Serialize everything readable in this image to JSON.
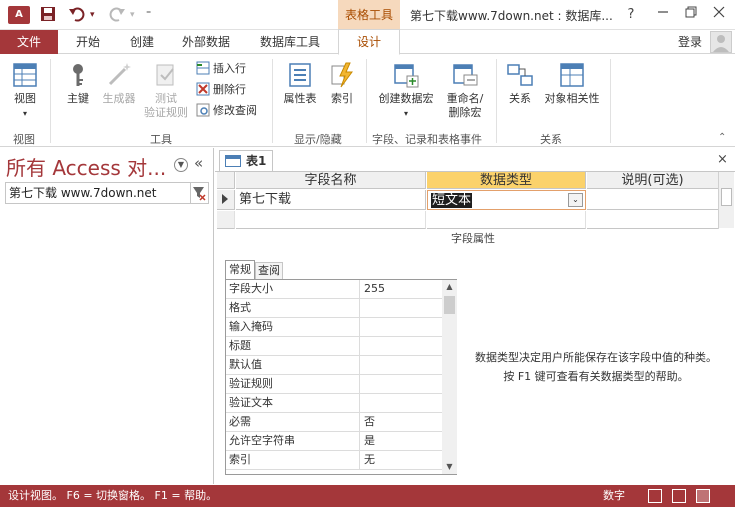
{
  "titlebar": {
    "app_logo": "A",
    "contextual_tab_title": "表格工具",
    "window_title": "第七下载www.7down.net : 数据库...",
    "help_label": "?",
    "qat_icons": [
      "save-icon",
      "undo-icon",
      "redo-icon",
      "customize-qat-icon"
    ],
    "minimize_icon": "minimize-icon",
    "restore_icon": "restore-icon",
    "close_icon": "close-icon"
  },
  "tabs": {
    "file": "文件",
    "items": [
      "开始",
      "创建",
      "外部数据",
      "数据库工具"
    ],
    "design": "设计",
    "login": "登录"
  },
  "ribbon": {
    "view": {
      "label": "视图",
      "group": "视图",
      "icon": "view-icon"
    },
    "tools": {
      "group": "工具",
      "primary_key": "主键",
      "builder": "生成器",
      "test_rules_1": "测试",
      "test_rules_2": "验证规则",
      "insert_row": "插入行",
      "delete_row": "删除行",
      "modify_lookups": "修改查阅"
    },
    "show_hide": {
      "group": "显示/隐藏",
      "property_sheet": "属性表",
      "indexes": "索引"
    },
    "events": {
      "group": "字段、记录和表格事件",
      "create_macros": "创建数据宏",
      "rename_1": "重命名/",
      "rename_2": "删除宏"
    },
    "relationships": {
      "group": "关系",
      "relationships": "关系",
      "object_dependencies": "对象相关性"
    },
    "collapse_icon": "chevron-up-icon"
  },
  "nav": {
    "title": "所有 Access 对...",
    "dropdown_icon": "chevron-down-icon",
    "shutter_label": "«",
    "search_value": "第七下载 www.7down.net",
    "filter_icon": "filter-clear-icon"
  },
  "document": {
    "tab_label": "表1",
    "tab_icon": "table-icon",
    "close_label": "×",
    "columns": {
      "field_name": "字段名称",
      "data_type": "数据类型",
      "description": "说明(可选)"
    },
    "row": {
      "field_name": "第七下载",
      "data_type": "短文本",
      "description": ""
    },
    "dropdown_label": "⌄",
    "properties_title": "字段属性",
    "prop_tabs": {
      "general": "常规",
      "lookup": "查阅"
    },
    "properties": [
      {
        "name": "字段大小",
        "value": "255"
      },
      {
        "name": "格式",
        "value": ""
      },
      {
        "name": "输入掩码",
        "value": ""
      },
      {
        "name": "标题",
        "value": ""
      },
      {
        "name": "默认值",
        "value": ""
      },
      {
        "name": "验证规则",
        "value": ""
      },
      {
        "name": "验证文本",
        "value": ""
      },
      {
        "name": "必需",
        "value": "否"
      },
      {
        "name": "允许空字符串",
        "value": "是"
      },
      {
        "name": "索引",
        "value": "无"
      }
    ],
    "help_text": "数据类型决定用户所能保存在该字段中值的种类。按 F1 键可查看有关数据类型的帮助。"
  },
  "status": {
    "text": "设计视图。  F6 = 切换窗格。  F1 = 帮助。",
    "numlock": "数字"
  },
  "colors": {
    "accent": "#a4373a",
    "contextual_tab": "#f6d9bd",
    "contextual_text": "#a84c00",
    "active_column": "#fbd26b"
  }
}
